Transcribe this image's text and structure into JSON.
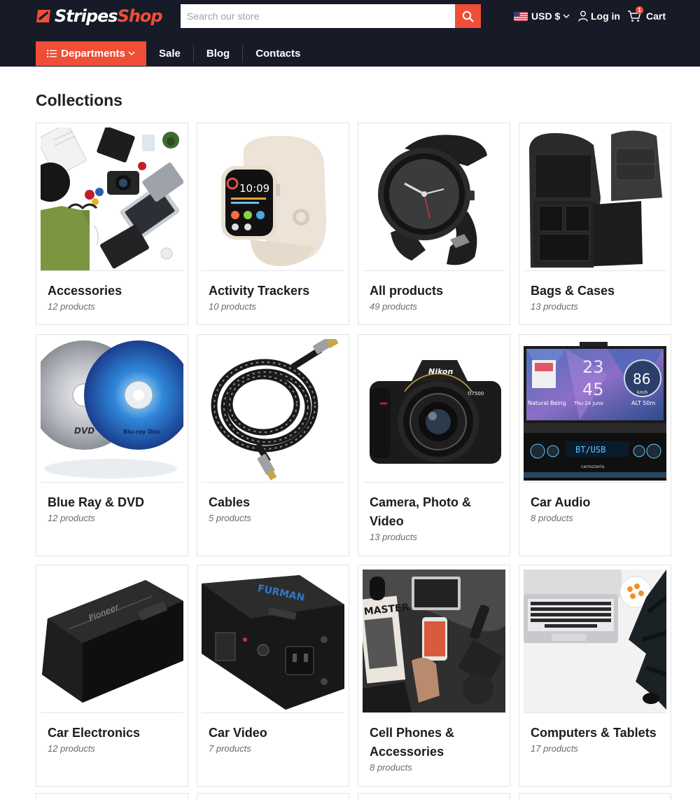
{
  "header": {
    "logo": {
      "part1": "Stripes",
      "part2": "Shop"
    },
    "search": {
      "placeholder": "Search our store"
    },
    "currency": {
      "flag": "US",
      "label": "USD $"
    },
    "login_label": "Log in",
    "cart": {
      "label": "Cart",
      "count": "1"
    }
  },
  "nav": {
    "departments_label": "Departments",
    "links": [
      "Sale",
      "Blog",
      "Contacts"
    ]
  },
  "page": {
    "title": "Collections"
  },
  "collections": [
    {
      "title": "Accessories",
      "count": "12 products"
    },
    {
      "title": "Activity Trackers",
      "count": "10 products"
    },
    {
      "title": "All products",
      "count": "49 products"
    },
    {
      "title": "Bags & Cases",
      "count": "13 products"
    },
    {
      "title": "Blue Ray & DVD",
      "count": "12 products"
    },
    {
      "title": "Cables",
      "count": "5 products"
    },
    {
      "title": "Camera, Photo & Video",
      "count": "13 products"
    },
    {
      "title": "Car Audio",
      "count": "8 products"
    },
    {
      "title": "Car Electronics",
      "count": "12 products"
    },
    {
      "title": "Car Video",
      "count": "7 products"
    },
    {
      "title": "Cell Phones & Accessories",
      "count": "8 products"
    },
    {
      "title": "Computers & Tablets",
      "count": "17 products"
    }
  ],
  "images": {
    "watch": {
      "time": "10:09"
    },
    "cd": {
      "dvd": "DVD",
      "bluray": "Blu-ray Disc"
    },
    "camera": {
      "brand": "Nikon",
      "model": "D7500"
    },
    "car_audio": {
      "time_top": "23",
      "time_bottom": "45",
      "speed": "86",
      "speed_unit": "km/h",
      "alt": "ALT 50m",
      "left_caption": "Natural Being",
      "time_caption": "Thu 24 June",
      "display": "BT/USB",
      "brand": "carrozzeria"
    },
    "amp": {
      "brand": "Pioneer"
    },
    "furman": {
      "brand": "FURMAN"
    },
    "magazine": {
      "title": "MASTER"
    }
  },
  "colors": {
    "header_bg": "#161b27",
    "accent": "#f04e37",
    "text": "#1c1c1c",
    "muted": "#6b6b6b"
  },
  "icons": {
    "search": "search-icon",
    "flag": "us-flag-icon",
    "chevron": "chevron-down-icon",
    "user": "user-icon",
    "cart": "cart-icon",
    "menu": "list-icon"
  }
}
